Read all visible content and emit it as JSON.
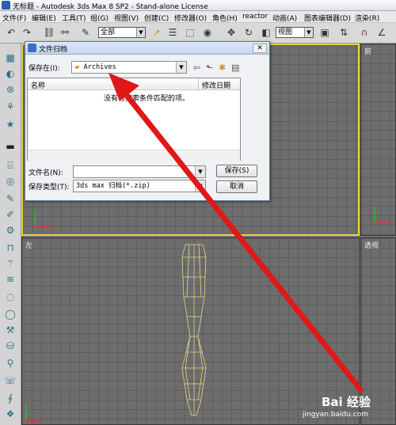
{
  "window": {
    "title": "无标题 - Autodesk 3ds Max 8 SP2  - Stand-alone License"
  },
  "menu": [
    "文件(F)",
    "编辑(E)",
    "工具(T)",
    "组(G)",
    "视图(V)",
    "创建(C)",
    "修改器(O)",
    "角色(H)",
    "reactor",
    "动画(A)",
    "图表编辑器(D)",
    "渲染(R)"
  ],
  "toolbar": {
    "selection_filter": "全部",
    "ref_coord": "视图"
  },
  "viewports": {
    "top_right_label": "前",
    "bottom_left_label": "左",
    "bottom_right_label": "透视"
  },
  "dialog": {
    "title": "文件归档",
    "save_in_label": "保存在(I):",
    "save_in_value": "Archives",
    "columns": [
      "名称",
      "修改日期"
    ],
    "empty_message": "没有与搜索条件匹配的项。",
    "filename_label": "文件名(N):",
    "filename_value": "",
    "filetype_label": "保存类型(T):",
    "filetype_value": "3ds max 归档(*.zip)",
    "save_button": "保存(S)",
    "cancel_button": "取消"
  },
  "watermark": {
    "brand": "Bai 经验",
    "url": "jingyan.baidu.com"
  },
  "colors": {
    "annotation_arrow": "#e01818",
    "active_viewport": "#e8d33c",
    "wireframe": "#e8d88a"
  }
}
